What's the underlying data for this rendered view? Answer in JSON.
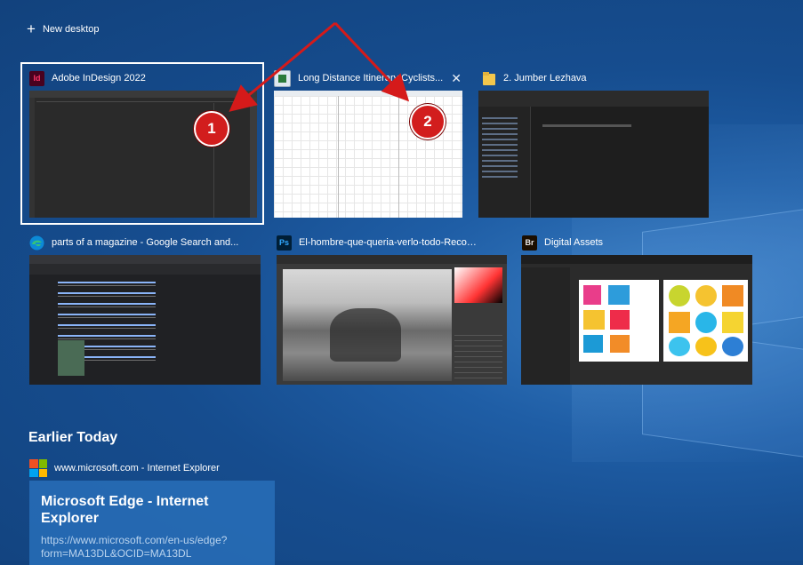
{
  "new_desktop_label": "New desktop",
  "windows": [
    {
      "title": "Adobe InDesign 2022",
      "icon": "indesign-icon",
      "icon_text": "Id",
      "icon_color": "#49021f",
      "icon_fg": "#ff3366"
    },
    {
      "title": "Long Distance Itinerary Cyclists...",
      "icon": "document-icon",
      "icon_text": "",
      "icon_color": "#dfe8f0",
      "icon_fg": "#2b7a3a"
    },
    {
      "title": "2. Jumber Lezhava",
      "icon": "folder-icon",
      "icon_text": "",
      "icon_color": "#f3c74c",
      "icon_fg": "#c9952a"
    },
    {
      "title": "parts of a magazine - Google Search and...",
      "icon": "edge-icon",
      "icon_text": "",
      "icon_color": "#0c8ad6",
      "icon_fg": "#35c37a"
    },
    {
      "title": "El-hombre-que-queria-verlo-todo-Recov...",
      "icon": "photoshop-icon",
      "icon_text": "Ps",
      "icon_color": "#001e36",
      "icon_fg": "#31a8ff"
    },
    {
      "title": "Digital Assets",
      "icon": "bridge-icon",
      "icon_text": "Br",
      "icon_color": "#1b0e00",
      "icon_fg": "#e8e8e8"
    }
  ],
  "close_glyph": "✕",
  "markers": {
    "one": "1",
    "two": "2"
  },
  "timeline": {
    "heading": "Earlier Today",
    "item_label": "www.microsoft.com - Internet Explorer",
    "card_title": "Microsoft Edge - Internet Explorer",
    "card_url": "https://www.microsoft.com/en-us/edge?form=MA13DL&OCID=MA13DL"
  },
  "accent_colors": {
    "marker": "#d21d1d",
    "arrow": "#d51a1a"
  }
}
